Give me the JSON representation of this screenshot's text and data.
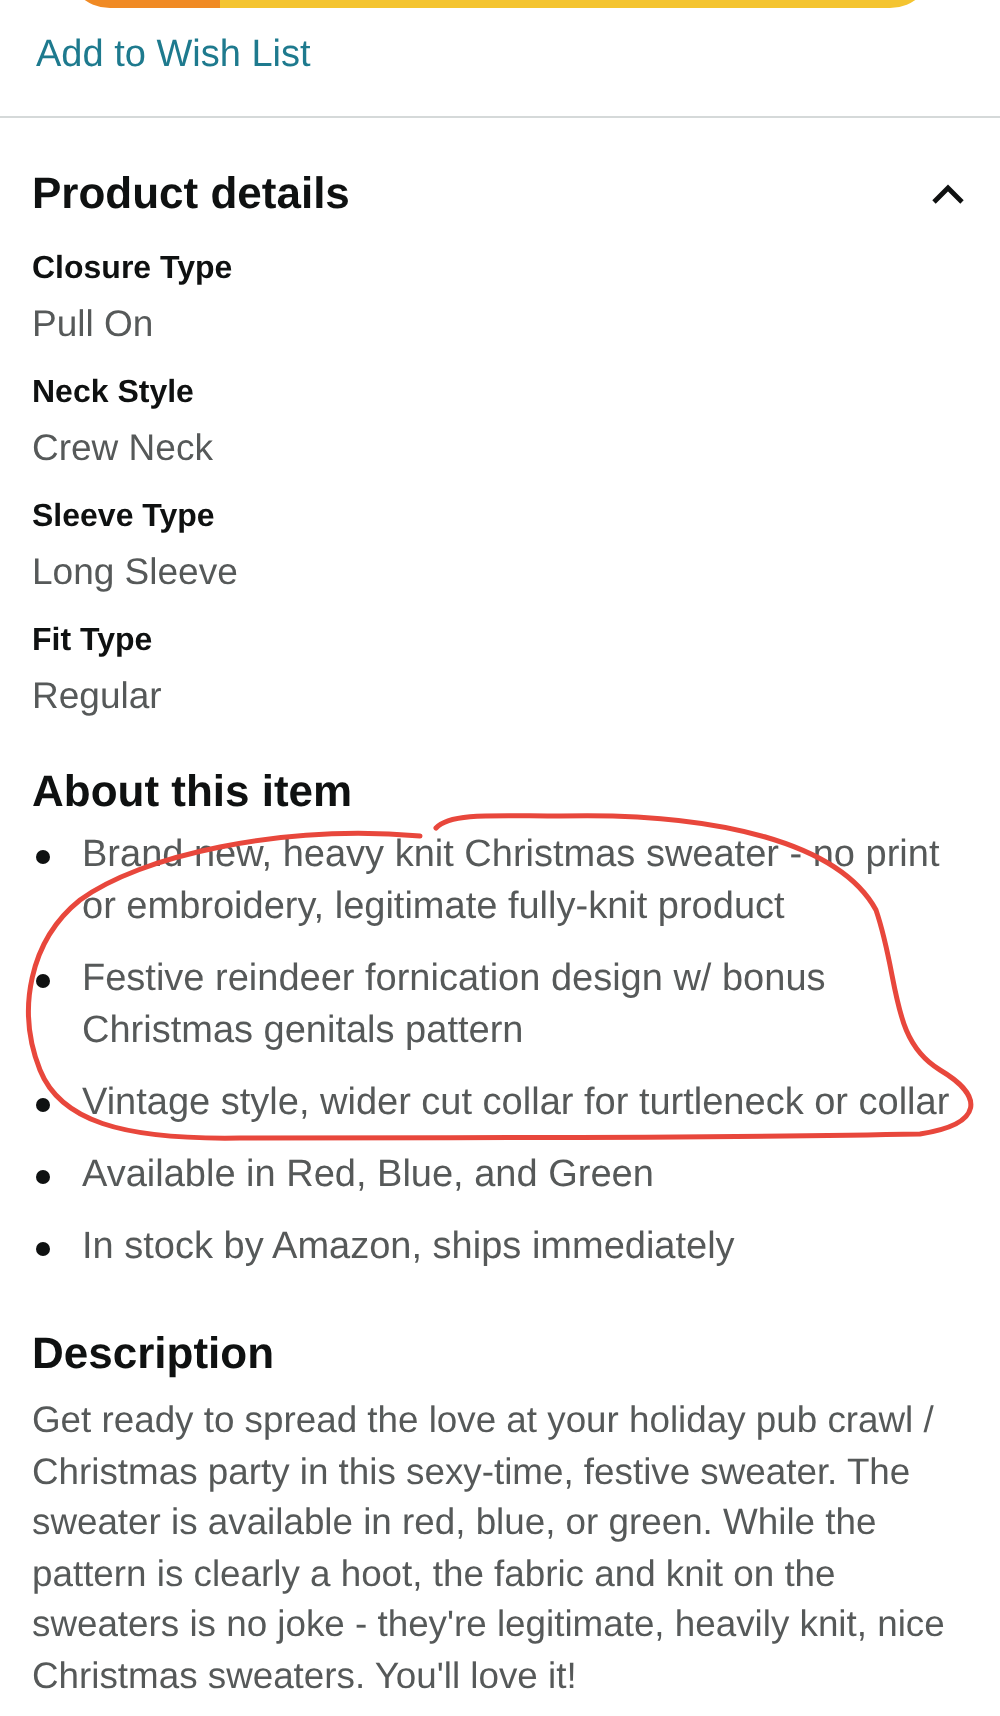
{
  "wish_list_link": "Add to Wish List",
  "product_details": {
    "title": "Product details",
    "expanded": true,
    "items": [
      {
        "label": "Closure Type",
        "value": "Pull On"
      },
      {
        "label": "Neck Style",
        "value": "Crew Neck"
      },
      {
        "label": "Sleeve Type",
        "value": "Long Sleeve"
      },
      {
        "label": "Fit Type",
        "value": "Regular"
      }
    ]
  },
  "about": {
    "title": "About this item",
    "bullets": [
      "Brand new, heavy knit Christmas sweater - no print or embroidery, legitimate fully-knit product",
      "Festive reindeer fornication design w/ bonus Christmas genitals pattern",
      "Vintage style, wider cut collar for turtleneck or collar",
      "Available in Red, Blue, and Green",
      "In stock by Amazon, ships immediately"
    ]
  },
  "description": {
    "title": "Description",
    "text": "Get ready to spread the love at your holiday pub crawl / Christmas party in this sexy-time, festive sweater. The sweater is available in red, blue, or green. While the pattern is clearly a hoot, the fabric and knit on the sweaters is no joke - they're legitimate, heavily knit, nice Christmas sweaters. You'll love it!"
  }
}
